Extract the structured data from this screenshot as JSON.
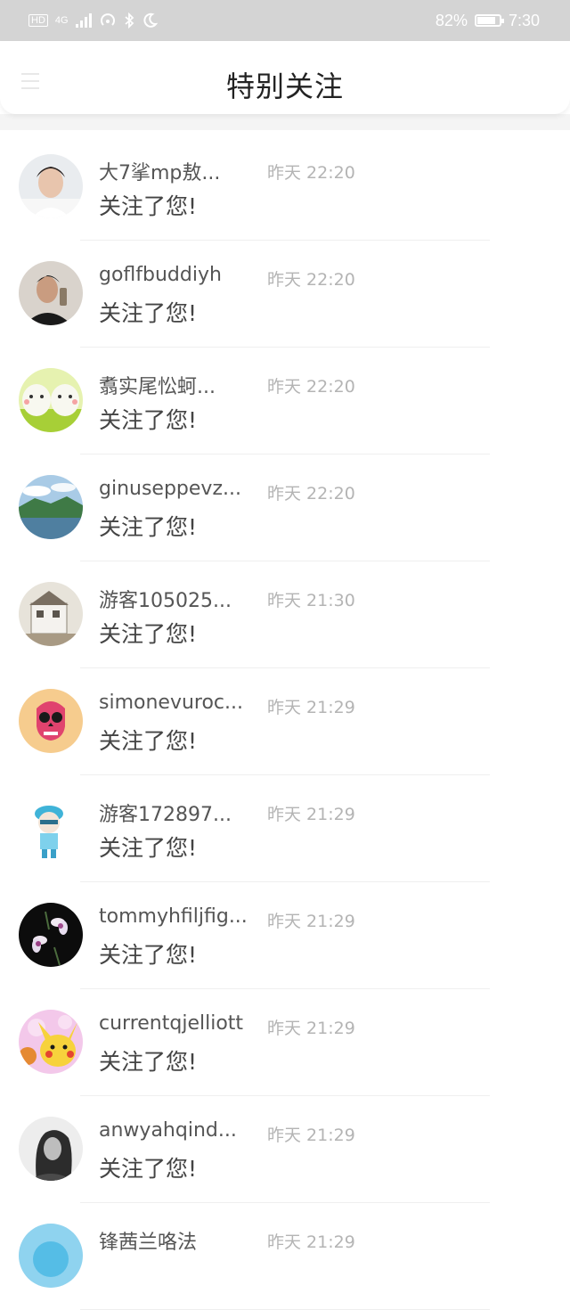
{
  "status_bar": {
    "network": "4G",
    "battery": "82%",
    "battery_level": 0.82,
    "time": "7:30"
  },
  "header": {
    "title": "特别关注"
  },
  "items": [
    {
      "name": "大7挲mp敖...",
      "time": "昨天 22:20",
      "message": "关注了您!",
      "avatar": "person-white-shirt"
    },
    {
      "name": "goflfbuddiyh",
      "time": "昨天 22:20",
      "message": "关注了您!",
      "avatar": "person-black-shirt"
    },
    {
      "name": "翥实尾忪蚵...",
      "time": "昨天 22:20",
      "message": "关注了您!",
      "avatar": "cartoon-eggs"
    },
    {
      "name": "ginuseppevz...",
      "time": "昨天 22:20",
      "message": "关注了您!",
      "avatar": "lake-landscape"
    },
    {
      "name": "游客105025...",
      "time": "昨天 21:30",
      "message": "关注了您!",
      "avatar": "white-building"
    },
    {
      "name": "simonevuroc...",
      "time": "昨天 21:29",
      "message": "关注了您!",
      "avatar": "pink-skull"
    },
    {
      "name": "游客172897...",
      "time": "昨天 21:29",
      "message": "关注了您!",
      "avatar": "cartoon-boy"
    },
    {
      "name": "tommyhfiljfig...",
      "time": "昨天 21:29",
      "message": "关注了您!",
      "avatar": "orchid-flowers"
    },
    {
      "name": "currentqjelliott",
      "time": "昨天 21:29",
      "message": "关注了您!",
      "avatar": "pikachu"
    },
    {
      "name": "anwyahqind...",
      "time": "昨天 21:29",
      "message": "关注了您!",
      "avatar": "woman-bw"
    },
    {
      "name": "锋茜兰咯法",
      "time": "昨天 21:29",
      "message": "",
      "avatar": "blue-partial"
    }
  ]
}
